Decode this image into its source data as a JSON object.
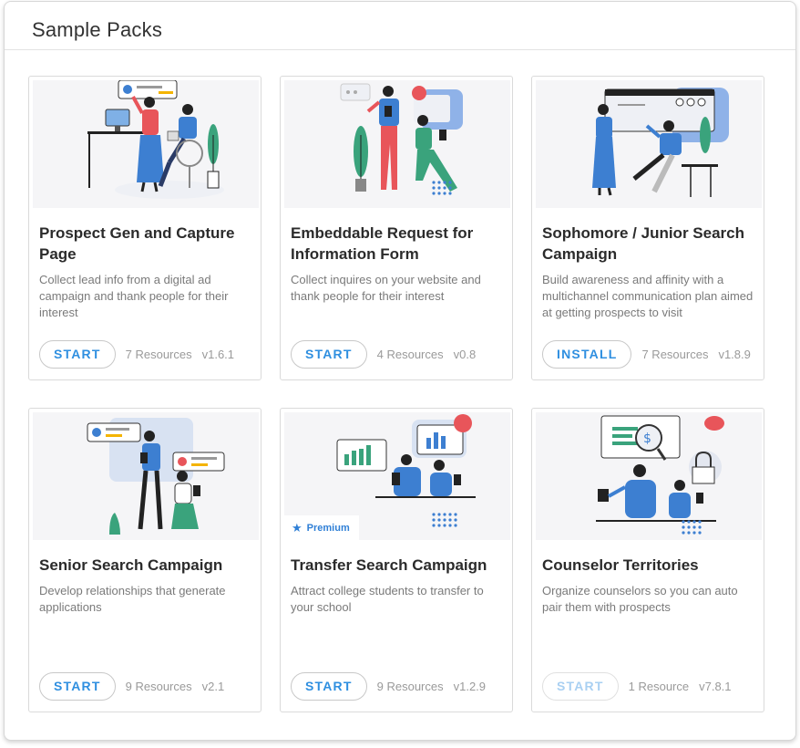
{
  "header": {
    "title": "Sample Packs"
  },
  "cards": [
    {
      "title": "Prospect Gen and Capture Page",
      "description": "Collect lead info from a digital ad campaign and thank people for their interest",
      "action": "START",
      "resources": "7 Resources",
      "version": "v1.6.1",
      "disabled": false,
      "premium": false
    },
    {
      "title": "Embeddable Request for Information Form",
      "description": "Collect inquires on your website and thank people for their interest",
      "action": "START",
      "resources": "4 Resources",
      "version": "v0.8",
      "disabled": false,
      "premium": false
    },
    {
      "title": "Sophomore / Junior Search Campaign",
      "description": "Build awareness and affinity with a multichannel communication plan aimed at getting prospects to visit",
      "action": "INSTALL",
      "resources": "7 Resources",
      "version": "v1.8.9",
      "disabled": false,
      "premium": false
    },
    {
      "title": "Senior Search Campaign",
      "description": "Develop relationships that generate applications",
      "action": "START",
      "resources": "9 Resources",
      "version": "v2.1",
      "disabled": false,
      "premium": false
    },
    {
      "title": "Transfer Search Campaign",
      "description": "Attract college students to transfer to your school",
      "action": "START",
      "resources": "9 Resources",
      "version": "v1.2.9",
      "disabled": false,
      "premium": true,
      "premium_label": "Premium"
    },
    {
      "title": "Counselor Territories",
      "description": "Organize counselors so you can auto pair them with prospects",
      "action": "START",
      "resources": "1 Resource",
      "version": "v7.8.1",
      "disabled": true,
      "premium": false
    }
  ],
  "colors": {
    "accent": "#2f8fe0",
    "illustration_blue": "#3d7fd1",
    "illustration_red": "#e8555a",
    "illustration_teal": "#3aa37c"
  }
}
